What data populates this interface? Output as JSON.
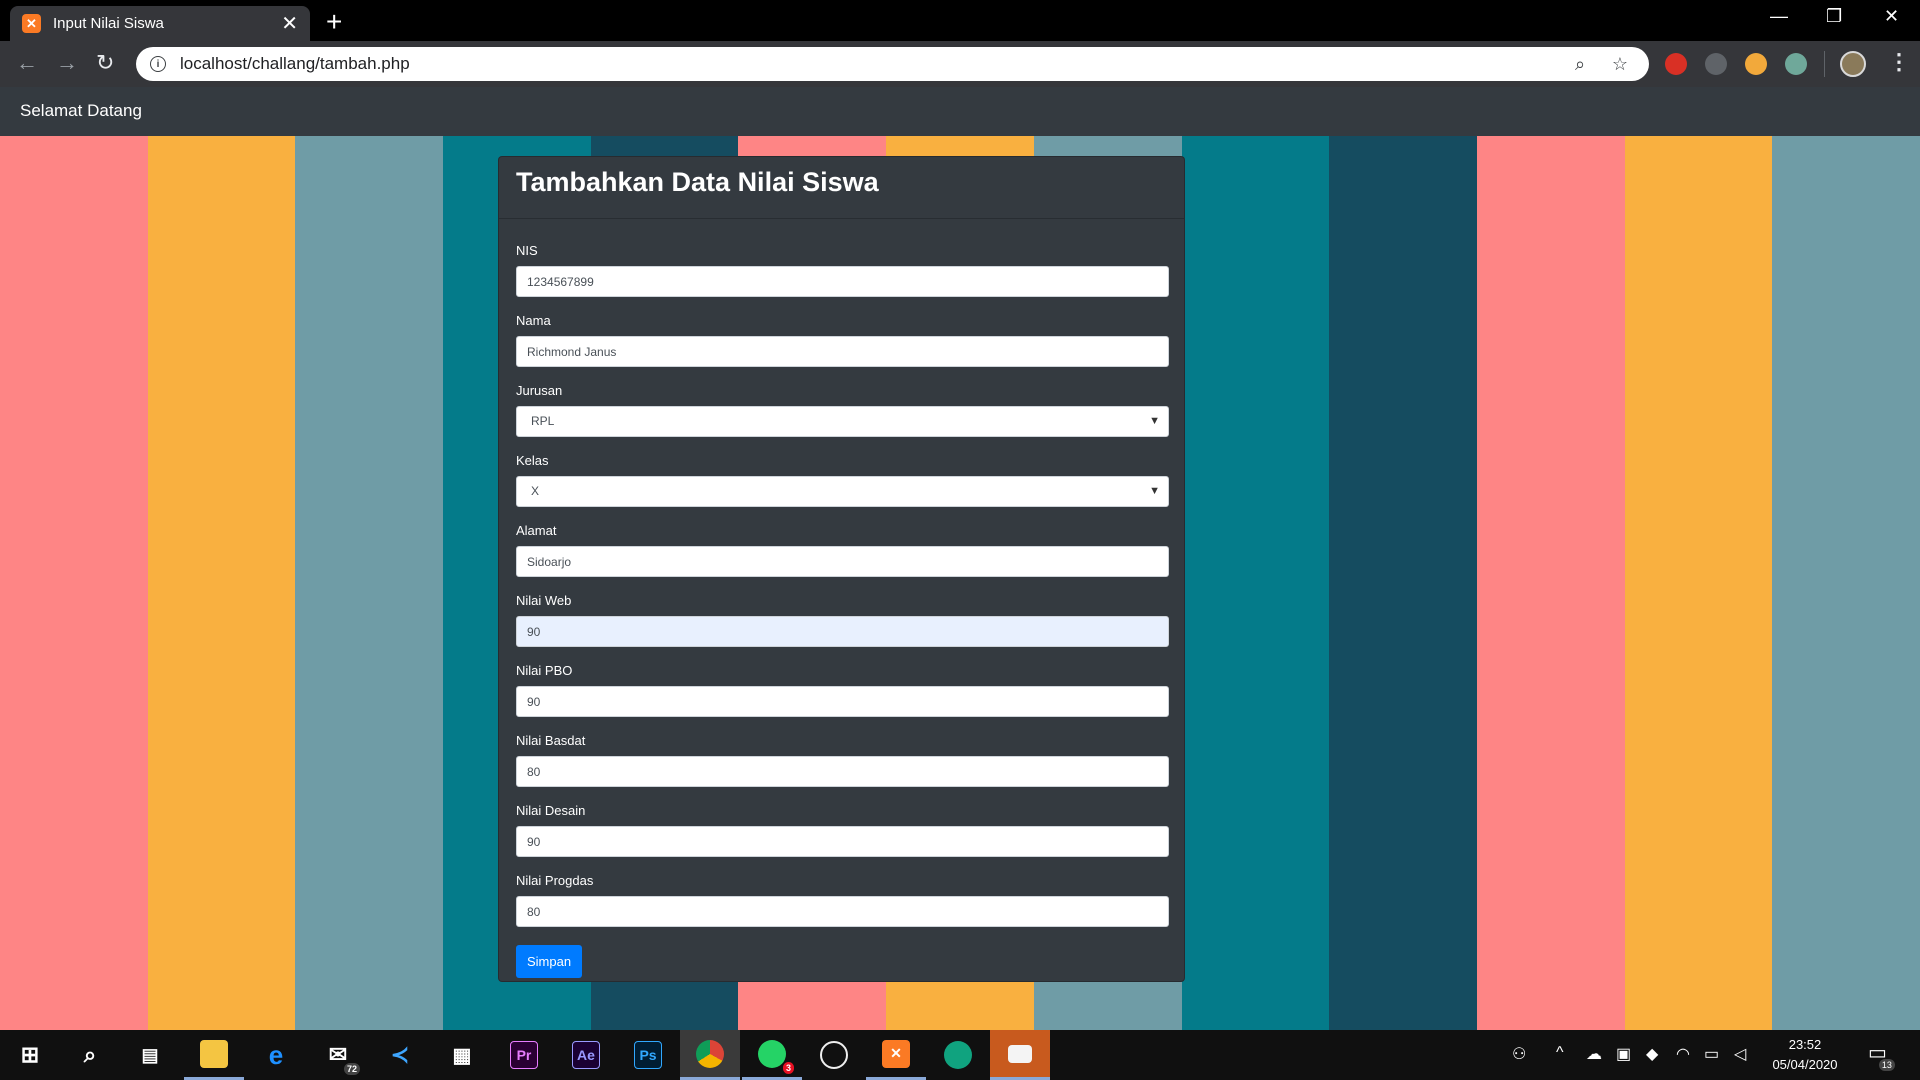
{
  "browser": {
    "tab_title": "Input Nilai Siswa",
    "url": "localhost/challang/tambah.php"
  },
  "navbar": {
    "brand": "Selamat Datang"
  },
  "stripe_colors": [
    "#fe8585",
    "#f9b040",
    "#6f9ca6",
    "#047b8a",
    "#154c60",
    "#fe8585",
    "#f9b040",
    "#6f9ca6",
    "#047b8a",
    "#154c60",
    "#fe8585",
    "#f9b040",
    "#6f9ca6"
  ],
  "card": {
    "title": "Tambahkan Data Nilai Siswa",
    "fields": {
      "nis": {
        "label": "NIS",
        "value": "1234567899"
      },
      "nama": {
        "label": "Nama",
        "value": "Richmond Janus"
      },
      "jurusan": {
        "label": "Jurusan",
        "value": "RPL"
      },
      "kelas": {
        "label": "Kelas",
        "value": "X"
      },
      "alamat": {
        "label": "Alamat",
        "value": "Sidoarjo"
      },
      "nilai_web": {
        "label": "Nilai Web",
        "value": "90"
      },
      "nilai_pbo": {
        "label": "Nilai PBO",
        "value": "90"
      },
      "nilai_basdat": {
        "label": "Nilai Basdat",
        "value": "80"
      },
      "nilai_desain": {
        "label": "Nilai Desain",
        "value": "90"
      },
      "nilai_progdas": {
        "label": "Nilai Progdas",
        "value": "80"
      }
    },
    "submit_label": "Simpan"
  },
  "taskbar": {
    "mail_badge": "72",
    "whatsapp_badge": "3",
    "time": "23:52",
    "date": "05/04/2020",
    "notification_count": "13"
  },
  "colors": {
    "accent_primary": "#007bff",
    "card_bg": "#343a40",
    "navbar_bg": "#343a40"
  }
}
